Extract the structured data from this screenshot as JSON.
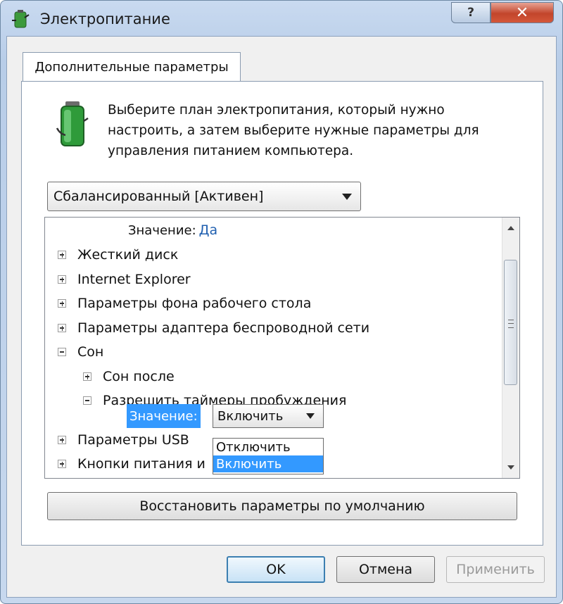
{
  "window": {
    "title": "Электропитание",
    "help_label": "?",
    "close_label": "✕"
  },
  "tab": {
    "label": "Дополнительные параметры"
  },
  "description": "Выберите план электропитания, который нужно настроить, а затем выберите нужные параметры для управления питанием компьютера.",
  "plan_select": {
    "value": "Сбалансированный [Активен]"
  },
  "tree": {
    "top_value_label": "Значение:",
    "top_value": "Да",
    "items": [
      {
        "label": "Жесткий диск",
        "expander": "plus"
      },
      {
        "label": "Internet Explorer",
        "expander": "plus"
      },
      {
        "label": "Параметры фона рабочего стола",
        "expander": "plus"
      },
      {
        "label": "Параметры адаптера беспроводной сети",
        "expander": "plus"
      },
      {
        "label": "Сон",
        "expander": "minus"
      },
      {
        "label": "Сон после",
        "expander": "plus"
      },
      {
        "label": "Разрешить таймеры пробуждения",
        "expander": "minus"
      },
      {
        "label": "Параметры USB",
        "expander": "plus"
      },
      {
        "label": "Кнопки питания и",
        "expander": "plus"
      }
    ],
    "value_label": "Значение:",
    "value_select": "Включить",
    "dropdown_options": [
      "Отключить",
      "Включить"
    ],
    "dropdown_selected": "Включить"
  },
  "restore_button": "Восстановить параметры по умолчанию",
  "buttons": {
    "ok": "OK",
    "cancel": "Отмена",
    "apply": "Применить"
  },
  "icons": {
    "app": "battery-plug-icon",
    "battery": "battery-icon"
  },
  "colors": {
    "highlight": "#3399ff",
    "link": "#2060b0",
    "close": "#c2452b"
  }
}
